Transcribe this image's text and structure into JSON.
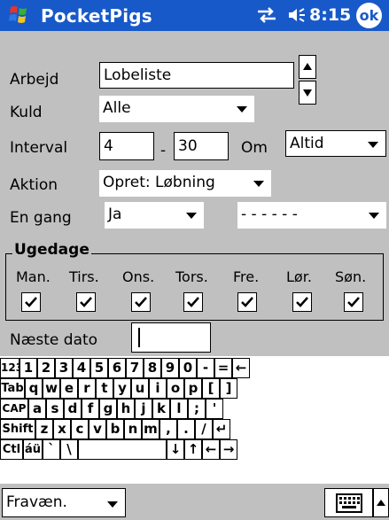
{
  "titlebar": {
    "app_title": "PocketPigs",
    "clock": "8:15",
    "ok_label": "ok",
    "start_icon": "windows-flag-icon",
    "connectivity_icon": "connectivity-icon",
    "speaker_icon": "speaker-icon",
    "color": "#1859c9"
  },
  "form": {
    "arbejd": {
      "label": "Arbejd",
      "value": "Lobeliste"
    },
    "kuld": {
      "label": "Kuld",
      "value": "Alle"
    },
    "interval": {
      "label": "Interval",
      "from": "4",
      "separator": "-",
      "to": "30",
      "om_label": "Om",
      "om_value": "Altid"
    },
    "aktion": {
      "label": "Aktion",
      "value": "Opret: Løbning"
    },
    "en_gang": {
      "label": "En gang",
      "value": "Ja",
      "value2": "- - - - - -"
    },
    "ugedage": {
      "title": "Ugedage",
      "days": [
        {
          "label": "Man.",
          "checked": true
        },
        {
          "label": "Tirs.",
          "checked": true
        },
        {
          "label": "Ons.",
          "checked": true
        },
        {
          "label": "Tors.",
          "checked": true
        },
        {
          "label": "Fre.",
          "checked": true
        },
        {
          "label": "Lør.",
          "checked": true
        },
        {
          "label": "Søn.",
          "checked": true
        }
      ]
    },
    "naeste_dato": {
      "label": "Næste dato",
      "value": ""
    }
  },
  "keyboard": {
    "rows": [
      [
        "123",
        "1",
        "2",
        "3",
        "4",
        "5",
        "6",
        "7",
        "8",
        "9",
        "0",
        "-",
        "=",
        "←"
      ],
      [
        "Tab",
        "q",
        "w",
        "e",
        "r",
        "t",
        "y",
        "u",
        "i",
        "o",
        "p",
        "[",
        "]"
      ],
      [
        "CAP",
        "a",
        "s",
        "d",
        "f",
        "g",
        "h",
        "j",
        "k",
        "l",
        ";",
        "'"
      ],
      [
        "Shift",
        "z",
        "x",
        "c",
        "v",
        "b",
        "n",
        "m",
        ",",
        ".",
        "/",
        "↵"
      ],
      [
        "Ctl",
        "áü",
        "`",
        "\\",
        "",
        "↓",
        "↑",
        "←",
        "→"
      ]
    ]
  },
  "bottombar": {
    "menu_value": "Fravæn.",
    "input_icon": "keyboard-icon"
  }
}
